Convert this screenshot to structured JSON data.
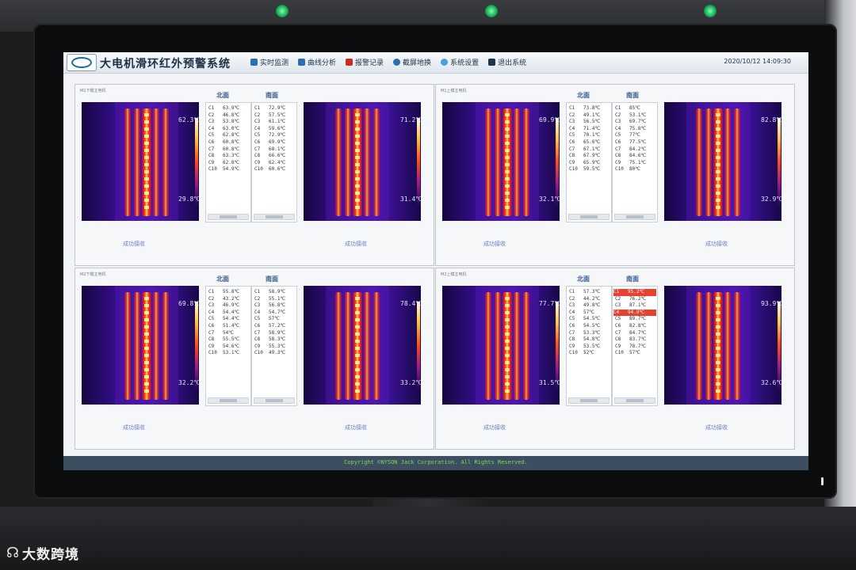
{
  "app": {
    "title": "大电机滑环红外预警系统",
    "datetime": "2020/10/12 14:09:30",
    "copyright": "Copyright ©NYSON Jack Corporation. All Rights Reserved."
  },
  "menu": [
    {
      "label": "实时监测",
      "icon": "monitor-icon"
    },
    {
      "label": "曲线分析",
      "icon": "curve-chart-icon"
    },
    {
      "label": "报警记录",
      "icon": "alarm-icon"
    },
    {
      "label": "截屏地换",
      "icon": "screenshot-icon"
    },
    {
      "label": "系统设置",
      "icon": "gear-icon"
    },
    {
      "label": "退出系统",
      "icon": "exit-icon"
    }
  ],
  "panels": [
    {
      "title": "M1下模主电机",
      "north_label": "北面",
      "south_label": "南面",
      "north": {
        "max": "62.3℃",
        "min": "29.8℃",
        "rows": [
          [
            "C1",
            "63.9℃"
          ],
          [
            "C2",
            "46.8℃"
          ],
          [
            "C3",
            "53.8℃"
          ],
          [
            "C4",
            "63.0℃"
          ],
          [
            "C5",
            "62.8℃"
          ],
          [
            "C6",
            "60.8℃"
          ],
          [
            "C7",
            "60.8℃"
          ],
          [
            "C8",
            "63.3℃"
          ],
          [
            "C9",
            "62.8℃"
          ],
          [
            "C10",
            "54.9℃"
          ]
        ],
        "status": "成功接收"
      },
      "south": {
        "max": "71.2℃",
        "min": "31.4℃",
        "rows": [
          [
            "C1",
            "72.9℃"
          ],
          [
            "C2",
            "57.5℃"
          ],
          [
            "C3",
            "61.1℃"
          ],
          [
            "C4",
            "59.6℃"
          ],
          [
            "C5",
            "72.9℃"
          ],
          [
            "C6",
            "69.9℃"
          ],
          [
            "C7",
            "68.1℃"
          ],
          [
            "C8",
            "66.6℃"
          ],
          [
            "C9",
            "62.4℃"
          ],
          [
            "C10",
            "60.6℃"
          ]
        ],
        "status": "成功接收"
      }
    },
    {
      "title": "M1上模主电机",
      "north_label": "北面",
      "south_label": "南面",
      "north": {
        "max": "69.9℃",
        "min": "32.1℃",
        "rows": [
          [
            "C1",
            "73.8℃"
          ],
          [
            "C2",
            "49.1℃"
          ],
          [
            "C3",
            "56.5℃"
          ],
          [
            "C4",
            "71.4℃"
          ],
          [
            "C5",
            "70.1℃"
          ],
          [
            "C6",
            "65.6℃"
          ],
          [
            "C7",
            "67.1℃"
          ],
          [
            "C8",
            "67.9℃"
          ],
          [
            "C9",
            "65.9℃"
          ],
          [
            "C10",
            "59.5℃"
          ]
        ],
        "status": "成功接收"
      },
      "south": {
        "max": "82.8℃",
        "min": "32.9℃",
        "rows": [
          [
            "C1",
            "85℃"
          ],
          [
            "C2",
            "53.1℃"
          ],
          [
            "C3",
            "69.7℃"
          ],
          [
            "C4",
            "75.8℃"
          ],
          [
            "C5",
            "77℃"
          ],
          [
            "C6",
            "77.5℃"
          ],
          [
            "C7",
            "84.2℃"
          ],
          [
            "C8",
            "84.6℃"
          ],
          [
            "C9",
            "75.1℃"
          ],
          [
            "C10",
            "80℃"
          ]
        ],
        "status": "成功接收"
      }
    },
    {
      "title": "M2下模主电机",
      "north_label": "北面",
      "south_label": "南面",
      "north": {
        "max": "69.8℃",
        "min": "32.2℃",
        "rows": [
          [
            "C1",
            "55.8℃"
          ],
          [
            "C2",
            "43.2℃"
          ],
          [
            "C3",
            "46.9℃"
          ],
          [
            "C4",
            "54.4℃"
          ],
          [
            "C5",
            "54.4℃"
          ],
          [
            "C6",
            "51.4℃"
          ],
          [
            "C7",
            "54℃"
          ],
          [
            "C8",
            "55.5℃"
          ],
          [
            "C9",
            "54.6℃"
          ],
          [
            "C10",
            "53.1℃"
          ]
        ],
        "status": "成功接收"
      },
      "south": {
        "max": "78.4℃",
        "min": "33.2℃",
        "rows": [
          [
            "C1",
            "58.9℃"
          ],
          [
            "C2",
            "55.1℃"
          ],
          [
            "C3",
            "56.8℃"
          ],
          [
            "C4",
            "54.7℃"
          ],
          [
            "C5",
            "57℃"
          ],
          [
            "C6",
            "57.2℃"
          ],
          [
            "C7",
            "58.9℃"
          ],
          [
            "C8",
            "58.3℃"
          ],
          [
            "C9",
            "55.3℃"
          ],
          [
            "C10",
            "49.3℃"
          ]
        ],
        "status": "成功接收"
      }
    },
    {
      "title": "M2上模主电机",
      "north_label": "北面",
      "south_label": "南面",
      "north": {
        "max": "77.7℃",
        "min": "31.5℃",
        "rows": [
          [
            "C1",
            "57.3℃"
          ],
          [
            "C2",
            "44.2℃"
          ],
          [
            "C3",
            "49.8℃"
          ],
          [
            "C4",
            "57℃"
          ],
          [
            "C5",
            "54.5℃"
          ],
          [
            "C6",
            "54.5℃"
          ],
          [
            "C7",
            "53.3℃"
          ],
          [
            "C8",
            "54.8℃"
          ],
          [
            "C9",
            "53.5℃"
          ],
          [
            "C10",
            "52℃"
          ]
        ],
        "status": "成功接收"
      },
      "south": {
        "max": "93.9℃",
        "min": "32.6℃",
        "rows": [
          [
            "C1",
            "95.2℃"
          ],
          [
            "C2",
            "76.2℃"
          ],
          [
            "C3",
            "87.1℃"
          ],
          [
            "C4",
            "94.9℃"
          ],
          [
            "C5",
            "89.7℃"
          ],
          [
            "C6",
            "82.8℃"
          ],
          [
            "C7",
            "84.7℃"
          ],
          [
            "C8",
            "83.7℃"
          ],
          [
            "C9",
            "78.7℃"
          ],
          [
            "C10",
            "57℃"
          ]
        ],
        "alarm_rows": [
          0,
          3
        ],
        "status": "成功接收"
      }
    }
  ],
  "watermark": {
    "text": "大数跨境"
  },
  "colors": {
    "alarm": "#e8412f",
    "footer": "#3c4e60",
    "copyright": "#7ed957",
    "status": "#6a80c9"
  }
}
